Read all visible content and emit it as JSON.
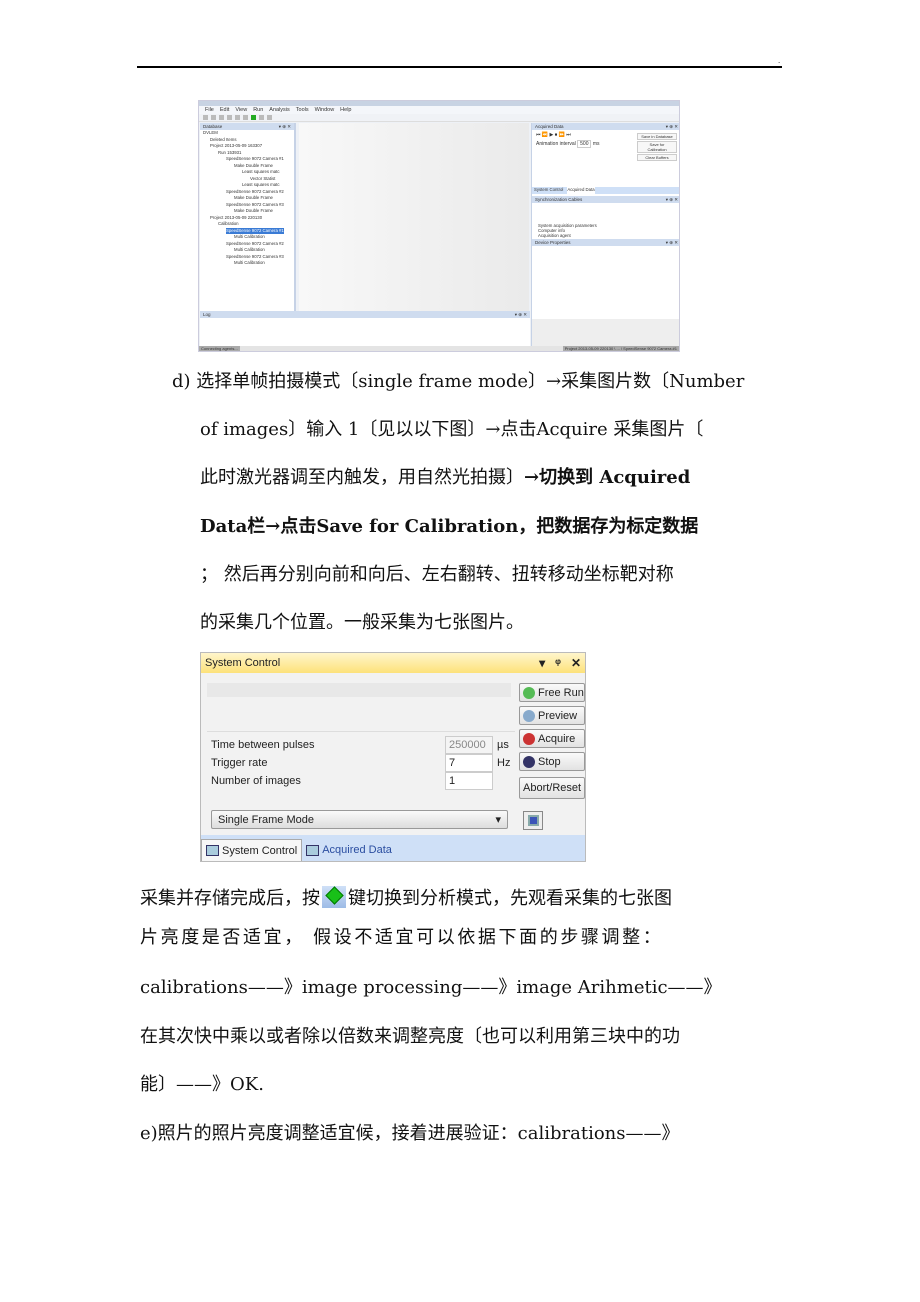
{
  "header": {
    "dot": "."
  },
  "app_screenshot": {
    "menu": [
      "File",
      "Edit",
      "View",
      "Run",
      "Analysis",
      "Tools",
      "Window",
      "Help"
    ],
    "database_pane": "Database",
    "tree": [
      "DVLEM",
      "Deleted Items",
      "Project 2013-05-09 163307",
      "Run 153931",
      "SpeedSense 9072 Camera #1",
      "Make Double Frame",
      "Least squares matc",
      "Vector Statist",
      "Least squares matc",
      "SpeedSense 9072 Camera #2",
      "Make Double Frame",
      "SpeedSense 9072 Camera #3",
      "Make Double Frame",
      "Project 2013-05-09 220130",
      "Calibration",
      "SpeedSense 9072 Camera #1",
      "Multi Calibration",
      "SpeedSense 9072 Camera #2",
      "Multi Calibration",
      "SpeedSense 9072 Camera #3",
      "Multi Calibration"
    ],
    "acquired_pane": "Acquired Data",
    "animation_label": "Animation interval",
    "animation_value": "500",
    "animation_unit": "ms",
    "buttons": [
      "Save in Database",
      "Save for Calibration",
      "Clear Buffers"
    ],
    "tabs": [
      "System Control",
      "Acquired Data"
    ],
    "sync_pane": "Synchronization Cables",
    "list": [
      "System acquisition parameters",
      "Computer info",
      "Acquisition agent"
    ],
    "device_pane": "Device Properties",
    "log_pane": "Log",
    "status_left": "Connecting agents...",
    "status_right": "Project 2013-05-09 220130 \\ ... \\ SpeedSense 9072 Camera #1"
  },
  "para_d": {
    "l1": "d) 选择单帧拍摄模式〔single frame mode〕→采集图片数〔Number",
    "l2": "of images〕输入 1〔见以以下图〕→点击Acquire 采集图片〔",
    "l3a": "此时激光器调至内触发，用自然光拍摄〕",
    "l3b": "→切换到 Acquired",
    "l4": "Data栏→点击Save for Calibration，把数据存为标定数据",
    "l5": "；  然后再分别向前和向后、左右翻转、扭转移动坐标靶对称",
    "l6": "的采集几个位置。一般采集为七张图片。"
  },
  "system_control": {
    "title": "System Control",
    "fields": [
      {
        "label": "Time between pulses",
        "value": "250000",
        "unit": "µs"
      },
      {
        "label": "Trigger rate",
        "value": "7",
        "unit": "Hz"
      },
      {
        "label": "Number of images",
        "value": "1",
        "unit": ""
      }
    ],
    "buttons": [
      "Free Run",
      "Preview",
      "Acquire",
      "Stop",
      "Abort/Reset"
    ],
    "mode": "Single Frame Mode",
    "tabs": [
      "System Control",
      "Acquired Data"
    ]
  },
  "para_after": {
    "l1a": "采集并存储完成后，按",
    "l1b": "键切换到分析模式，先观看采集的七张图",
    "l2": "片亮度是否适宜，  假设不适宜可以依据下面的步骤调整：",
    "l3": "calibrations——》image processing——》image Arihmetic——》",
    "l4": "在其次快中乘以或者除以倍数来调整亮度〔也可以利用第三块中的功",
    "l5": "能〕——》OK.",
    "l6": "e)照片的照片亮度调整适宜候，接着进展验证：calibrations——》"
  }
}
